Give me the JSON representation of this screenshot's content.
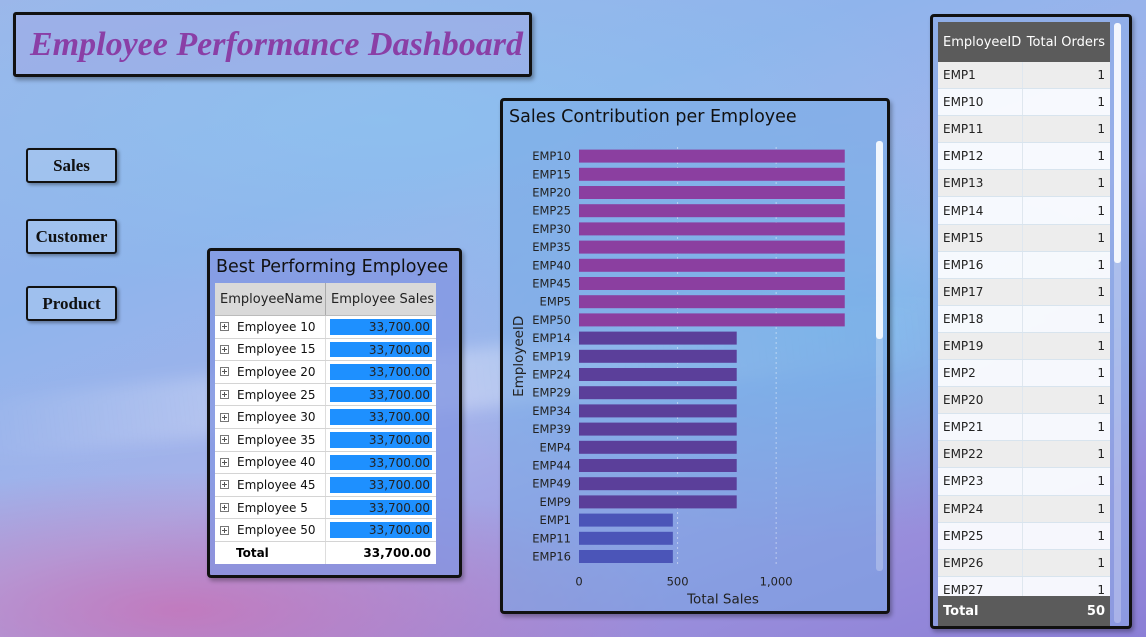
{
  "dashboard": {
    "title": "Employee Performance Dashboard"
  },
  "nav": {
    "sales": "Sales",
    "customer": "Customer",
    "product": "Product"
  },
  "best_employee": {
    "title": "Best Performing Employee",
    "columns": [
      "EmployeeName",
      "Employee Sales"
    ],
    "rows": [
      {
        "name": "Employee 10",
        "sales": "33,700.00"
      },
      {
        "name": "Employee 15",
        "sales": "33,700.00"
      },
      {
        "name": "Employee 20",
        "sales": "33,700.00"
      },
      {
        "name": "Employee 25",
        "sales": "33,700.00"
      },
      {
        "name": "Employee 30",
        "sales": "33,700.00"
      },
      {
        "name": "Employee 35",
        "sales": "33,700.00"
      },
      {
        "name": "Employee 40",
        "sales": "33,700.00"
      },
      {
        "name": "Employee 45",
        "sales": "33,700.00"
      },
      {
        "name": "Employee 5",
        "sales": "33,700.00"
      },
      {
        "name": "Employee 50",
        "sales": "33,700.00"
      }
    ],
    "total_label": "Total",
    "total_value": "33,700.00",
    "bar_color": "#1e90ff"
  },
  "chart_data": {
    "type": "bar",
    "orientation": "horizontal",
    "title": "Sales Contribution per Employee",
    "xlabel": "Total Sales",
    "ylabel": "EmployeeID",
    "xlim": [
      0,
      1400
    ],
    "xticks": [
      0,
      500,
      1000
    ],
    "xtick_labels": [
      "0",
      "500",
      "1,000"
    ],
    "grid": true,
    "categories": [
      "EMP10",
      "EMP15",
      "EMP20",
      "EMP25",
      "EMP30",
      "EMP35",
      "EMP40",
      "EMP45",
      "EMP5",
      "EMP50",
      "EMP14",
      "EMP19",
      "EMP24",
      "EMP29",
      "EMP34",
      "EMP39",
      "EMP4",
      "EMP44",
      "EMP49",
      "EMP9",
      "EMP1",
      "EMP11",
      "EMP16"
    ],
    "values": [
      1348,
      1348,
      1348,
      1348,
      1348,
      1348,
      1348,
      1348,
      1348,
      1348,
      800,
      800,
      800,
      800,
      800,
      800,
      800,
      800,
      800,
      800,
      476,
      476,
      476
    ],
    "colors": [
      "#8b3fa0",
      "#8b3fa0",
      "#8b3fa0",
      "#8b3fa0",
      "#8b3fa0",
      "#8b3fa0",
      "#8b3fa0",
      "#8b3fa0",
      "#8b3fa0",
      "#8b3fa0",
      "#5b3f9a",
      "#5b3f9a",
      "#5b3f9a",
      "#5b3f9a",
      "#5b3f9a",
      "#5b3f9a",
      "#5b3f9a",
      "#5b3f9a",
      "#5b3f9a",
      "#5b3f9a",
      "#4b55b8",
      "#4b55b8",
      "#4b55b8"
    ]
  },
  "orders": {
    "columns": [
      "EmployeeID",
      "Total Orders"
    ],
    "rows": [
      {
        "id": "EMP1",
        "orders": "1"
      },
      {
        "id": "EMP10",
        "orders": "1"
      },
      {
        "id": "EMP11",
        "orders": "1"
      },
      {
        "id": "EMP12",
        "orders": "1"
      },
      {
        "id": "EMP13",
        "orders": "1"
      },
      {
        "id": "EMP14",
        "orders": "1"
      },
      {
        "id": "EMP15",
        "orders": "1"
      },
      {
        "id": "EMP16",
        "orders": "1"
      },
      {
        "id": "EMP17",
        "orders": "1"
      },
      {
        "id": "EMP18",
        "orders": "1"
      },
      {
        "id": "EMP19",
        "orders": "1"
      },
      {
        "id": "EMP2",
        "orders": "1"
      },
      {
        "id": "EMP20",
        "orders": "1"
      },
      {
        "id": "EMP21",
        "orders": "1"
      },
      {
        "id": "EMP22",
        "orders": "1"
      },
      {
        "id": "EMP23",
        "orders": "1"
      },
      {
        "id": "EMP24",
        "orders": "1"
      },
      {
        "id": "EMP25",
        "orders": "1"
      },
      {
        "id": "EMP26",
        "orders": "1"
      },
      {
        "id": "EMP27",
        "orders": "1"
      }
    ],
    "total_label": "Total",
    "total_value": "50"
  }
}
